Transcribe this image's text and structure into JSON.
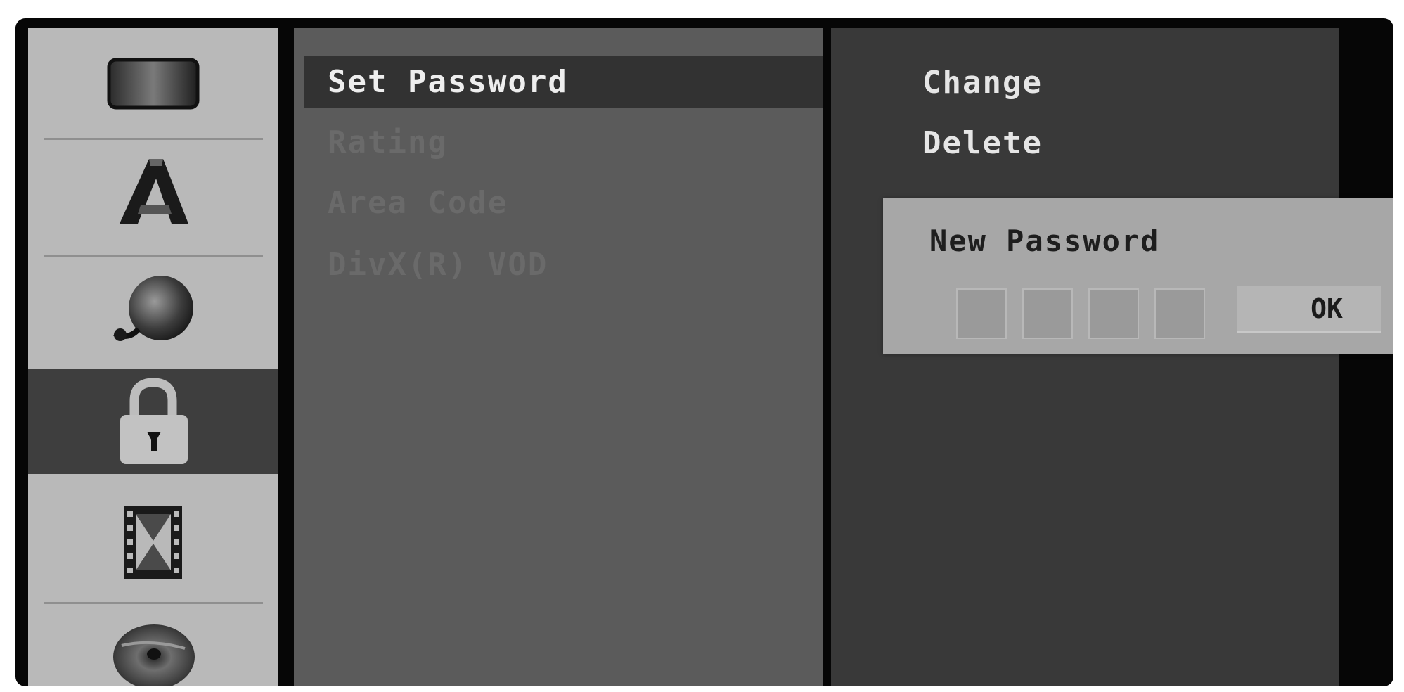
{
  "sidebar": {
    "items": [
      {
        "icon": "tv-screen-icon",
        "selected": false
      },
      {
        "icon": "language-icon",
        "selected": false
      },
      {
        "icon": "audio-speaker-icon",
        "selected": false
      },
      {
        "icon": "lock-icon",
        "selected": true
      },
      {
        "icon": "film-icon",
        "selected": false
      },
      {
        "icon": "disc-icon",
        "selected": false
      }
    ]
  },
  "menu": {
    "items": [
      {
        "label": "Set Password",
        "selected": true
      },
      {
        "label": "Rating",
        "selected": false
      },
      {
        "label": "Area Code",
        "selected": false
      },
      {
        "label": "DivX(R) VOD",
        "selected": false
      }
    ]
  },
  "options": {
    "items": [
      {
        "label": "Change"
      },
      {
        "label": "Delete"
      }
    ]
  },
  "popup": {
    "title": "New Password",
    "digits": [
      "",
      "",
      "",
      ""
    ],
    "ok_label": "OK"
  },
  "colors": {
    "icon_column_bg": "#b9b9b9",
    "menu_panel_bg": "#5b5b5b",
    "option_panel_bg": "#393939",
    "selected_bg": "#3e3e3e",
    "popup_bg": "#a7a7a7"
  }
}
